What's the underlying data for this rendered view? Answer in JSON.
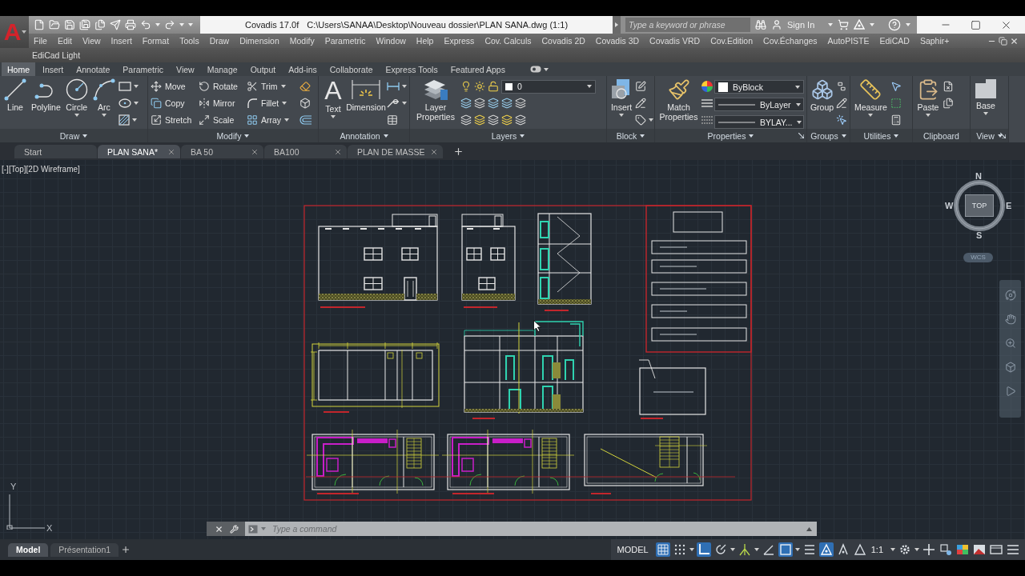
{
  "app_button": {
    "logo": "A"
  },
  "title_bar": {
    "app_name": "Covadis 17.0f",
    "file_path": "C:\\Users\\SANAA\\Desktop\\Nouveau dossier\\PLAN SANA.dwg (1:1)"
  },
  "search": {
    "placeholder": "Type a keyword or phrase"
  },
  "account": {
    "label": "Sign In"
  },
  "menu_bar": [
    "File",
    "Edit",
    "View",
    "Insert",
    "Format",
    "Tools",
    "Draw",
    "Dimension",
    "Modify",
    "Parametric",
    "Window",
    "Help",
    "Express",
    "Cov. Calculs",
    "Covadis 2D",
    "Covadis 3D",
    "Covadis VRD",
    "Cov.Edition",
    "Cov.Échanges",
    "AutoPISTE",
    "EdiCAD",
    "Saphir+"
  ],
  "menu_bar_2": [
    "EdiCad Light"
  ],
  "ribbon_tabs": [
    {
      "label": "Home",
      "selected": true
    },
    {
      "label": "Insert",
      "selected": false
    },
    {
      "label": "Annotate",
      "selected": false
    },
    {
      "label": "Parametric",
      "selected": false
    },
    {
      "label": "View",
      "selected": false
    },
    {
      "label": "Manage",
      "selected": false
    },
    {
      "label": "Output",
      "selected": false
    },
    {
      "label": "Add-ins",
      "selected": false
    },
    {
      "label": "Collaborate",
      "selected": false
    },
    {
      "label": "Express Tools",
      "selected": false
    },
    {
      "label": "Featured Apps",
      "selected": false
    }
  ],
  "ribbon_panels": [
    {
      "kind": "draw",
      "title": "Draw",
      "title_menu": true,
      "launcher": false,
      "tools": [
        {
          "label": "Line",
          "dropdown": false
        },
        {
          "label": "Polyline",
          "dropdown": false
        },
        {
          "label": "Circle",
          "dropdown": true
        },
        {
          "label": "Arc",
          "dropdown": true
        }
      ]
    },
    {
      "kind": "modify",
      "title": "Modify",
      "title_menu": true,
      "launcher": false,
      "tools": [
        {
          "label": "Move",
          "dropdown": false
        },
        {
          "label": "Rotate",
          "dropdown": false
        },
        {
          "label": "Trim",
          "dropdown": true
        },
        {
          "label": "Copy",
          "dropdown": false
        },
        {
          "label": "Mirror",
          "dropdown": false
        },
        {
          "label": "Fillet",
          "dropdown": true
        },
        {
          "label": "Stretch",
          "dropdown": false
        },
        {
          "label": "Scale",
          "dropdown": false
        },
        {
          "label": "Array",
          "dropdown": true
        }
      ]
    },
    {
      "kind": "annotation",
      "title": "Annotation",
      "title_menu": true,
      "launcher": false,
      "tools": [
        {
          "label": "Text",
          "glyph": "A",
          "dropdown": true
        },
        {
          "label": "Dimension",
          "dropdown": false
        }
      ]
    },
    {
      "kind": "layers",
      "title": "Layers",
      "title_menu": true,
      "launcher": false,
      "tools": [
        {
          "label": "Layer Properties",
          "dropdown": false
        }
      ],
      "layer": {
        "value": "0"
      }
    },
    {
      "kind": "block",
      "title": "Block",
      "title_menu": true,
      "launcher": false,
      "tools": [
        {
          "label": "Insert",
          "dropdown": true
        }
      ]
    },
    {
      "kind": "properties",
      "title": "Properties",
      "title_menu": true,
      "launcher": true,
      "tools": [
        {
          "label": "Match Properties",
          "dropdown": false
        }
      ],
      "selectors": [
        {
          "kind": "color",
          "value": "ByBlock"
        },
        {
          "kind": "lineweight",
          "value": "ByLayer"
        },
        {
          "kind": "linetype",
          "value": "BYLAY..."
        }
      ]
    },
    {
      "kind": "groups",
      "title": "Groups",
      "title_menu": true,
      "launcher": false,
      "tools": [
        {
          "label": "Group",
          "dropdown": false
        }
      ]
    },
    {
      "kind": "utilities",
      "title": "Utilities",
      "title_menu": true,
      "launcher": false,
      "tools": [
        {
          "label": "Measure",
          "dropdown": true
        }
      ]
    },
    {
      "kind": "clipboard",
      "title": "Clipboard",
      "title_menu": false,
      "launcher": false,
      "tools": [
        {
          "label": "Paste",
          "dropdown": true
        }
      ]
    },
    {
      "kind": "view",
      "title": "View",
      "title_menu": true,
      "launcher": true,
      "tools": [
        {
          "label": "Base",
          "dropdown": true
        }
      ]
    }
  ],
  "file_tabs": [
    {
      "label": "Start",
      "selected": false,
      "closable": false
    },
    {
      "label": "PLAN SANA*",
      "selected": true,
      "closable": true
    },
    {
      "label": "BA 50",
      "selected": false,
      "closable": true
    },
    {
      "label": "BA100",
      "selected": false,
      "closable": true
    },
    {
      "label": "PLAN DE MASSE",
      "selected": false,
      "closable": true
    }
  ],
  "viewport": {
    "controls": [
      "[-]",
      "[Top]",
      "[2D Wireframe]"
    ]
  },
  "viewcube": {
    "north": "N",
    "west": "W",
    "east": "E",
    "south": "S",
    "face": "TOP",
    "ucs": "WCS"
  },
  "ucs_icon": {
    "y_label": "Y",
    "x_label": "X"
  },
  "command_line": {
    "placeholder": "Type a command"
  },
  "layout_tabs": [
    {
      "label": "Model",
      "selected": true
    },
    {
      "label": "Présentation1",
      "selected": false
    }
  ],
  "status_bar": {
    "space": "MODEL",
    "tools": [
      {
        "on": true,
        "dropdown": false
      },
      {
        "on": false,
        "dropdown": true
      },
      {
        "on": true,
        "dropdown": false
      },
      {
        "on": false,
        "dropdown": true
      },
      {
        "on": false,
        "dropdown": true
      },
      {
        "on": false,
        "dropdown": false
      },
      {
        "on": true,
        "dropdown": true
      },
      {
        "on": false,
        "dropdown": false
      },
      {
        "on": true,
        "dropdown": false
      },
      {
        "on": false,
        "dropdown": false
      },
      {
        "on": false,
        "dropdown": false
      }
    ],
    "scale": "1:1",
    "more_tools": [
      {
        "on": false,
        "dropdown": true
      },
      {
        "on": false,
        "dropdown": false
      },
      {
        "on": false,
        "dropdown": false
      },
      {
        "on": false,
        "dropdown": false
      },
      {
        "on": false,
        "dropdown": false
      },
      {
        "on": false,
        "dropdown": false
      },
      {
        "on": false,
        "dropdown": false
      }
    ]
  }
}
